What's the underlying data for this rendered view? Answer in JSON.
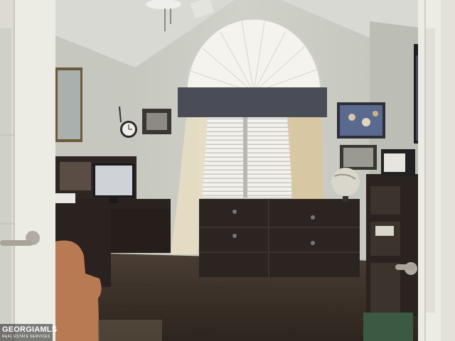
{
  "photo": {
    "subject": "home-office-room",
    "palette": {
      "wall": "#c9cac2",
      "ceiling": "#d8d8d2",
      "floor": "#3a3028",
      "furniture": "#2e2622",
      "curtain": "#e2d6b8",
      "valance": "#4a4c58",
      "armchair": "#b87a52",
      "door": "#ece9e2"
    }
  },
  "watermark": {
    "brand": "GEORGIAMLS",
    "tagline": "REAL ESTATE SERVICES"
  }
}
